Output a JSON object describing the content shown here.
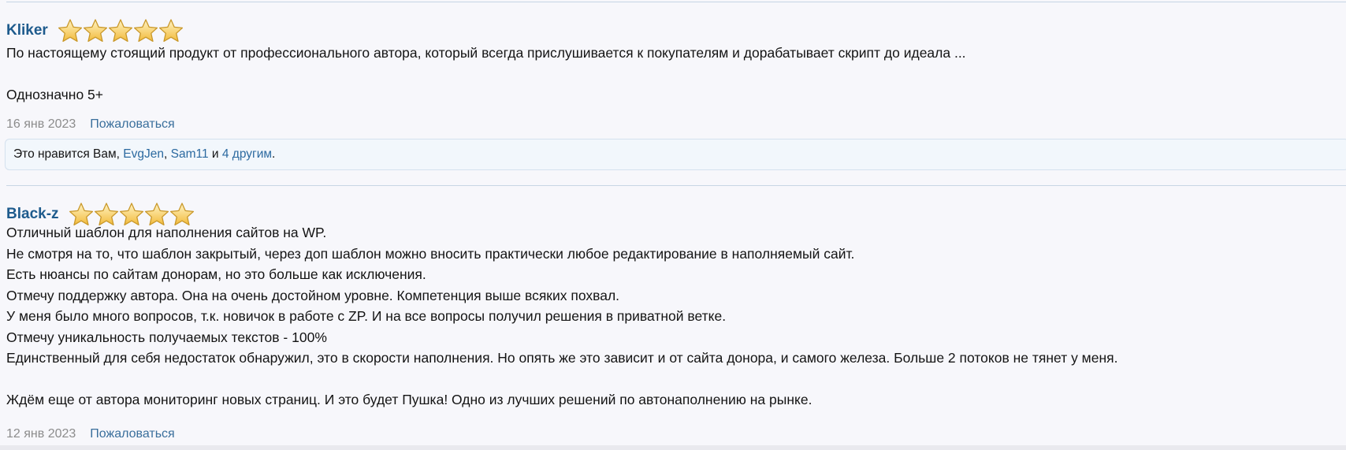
{
  "reviews": [
    {
      "author": "Kliker",
      "rating": 5,
      "rating_max": 5,
      "text": "По настоящему стоящий продукт от профессионального автора, который всегда прислушивается к покупателям и дорабатывает скрипт до идеала ...\n\nОднозначно 5+",
      "date": "16 янв 2023",
      "report_label": "Пожаловаться",
      "likes": {
        "prefix": "Это нравится Вам, ",
        "user1": "EvgJen",
        "sep": ", ",
        "user2": "Sam11",
        "conj": " и ",
        "others": "4 другим",
        "suffix": "."
      }
    },
    {
      "author": "Black-z",
      "rating": 5,
      "rating_max": 5,
      "text": "Отличный шаблон для наполнения сайтов на WP.\nНе смотря на то, что шаблон закрытый, через доп шаблон можно вносить практически любое редактирование в наполняемый сайт.\nЕсть нюансы по сайтам донорам, но это больше как исключения.\nОтмечу поддержку автора. Она на очень достойном уровне. Компетенция выше всяких похвал.\nУ меня было много вопросов, т.к. новичок в работе с ZP. И на все вопросы получил решения в приватной ветке.\nОтмечу уникальность получаемых текстов - 100%\nЕдинственный для себя недостаток обнаружил, это в скорости наполнения. Но опять же это зависит и от сайта донора, и самого железа. Больше 2 потоков не тянет у меня.\n\nЖдём еще от автора мониторинг новых страниц. И это будет Пушка! Одно из лучших решений по автонаполнению на рынке.",
      "date": "12 янв 2023",
      "report_label": "Пожаловаться"
    }
  ],
  "colors": {
    "author": "#1e5b8d",
    "link": "#3a6f9c",
    "date": "#8c8c8c",
    "star_fill": "#f5c84a",
    "star_stroke": "#c9982a"
  },
  "icons": {
    "star": "star-icon"
  }
}
